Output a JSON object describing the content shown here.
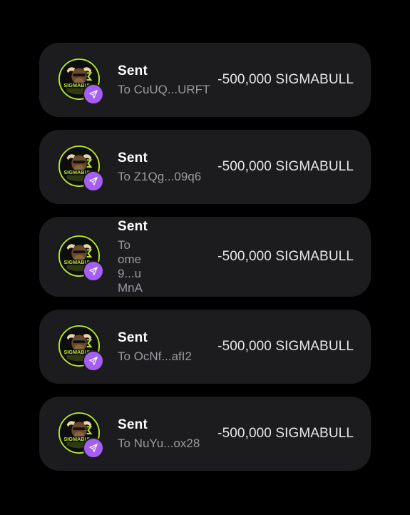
{
  "transactions": [
    {
      "title": "Sent",
      "recipient": "To CuUQ...URFT",
      "amount": "-500,000 SIGMABULL",
      "token_logo_text": "SIGMABULL",
      "token_icon": "sigmabull-logo-icon",
      "action_icon": "send-icon"
    },
    {
      "title": "Sent",
      "recipient": "To Z1Qg...09q6",
      "amount": "-500,000 SIGMABULL",
      "token_logo_text": "SIGMABULL",
      "token_icon": "sigmabull-logo-icon",
      "action_icon": "send-icon"
    },
    {
      "title": "Sent",
      "recipient": "To ome9...uMnA",
      "amount": "-500,000 SIGMABULL",
      "token_logo_text": "SIGMABULL",
      "token_icon": "sigmabull-logo-icon",
      "action_icon": "send-icon"
    },
    {
      "title": "Sent",
      "recipient": "To OcNf...afI2",
      "amount": "-500,000 SIGMABULL",
      "token_logo_text": "SIGMABULL",
      "token_icon": "sigmabull-logo-icon",
      "action_icon": "send-icon"
    },
    {
      "title": "Sent",
      "recipient": "To NuYu...ox28",
      "amount": "-500,000 SIGMABULL",
      "token_logo_text": "SIGMABULL",
      "token_icon": "sigmabull-logo-icon",
      "action_icon": "send-icon"
    }
  ],
  "colors": {
    "background": "#000000",
    "card": "#1c1c1e",
    "badge": "#a45ef2",
    "logo_green": "#b8e62a",
    "title_text": "#ffffff",
    "sub_text": "#9a9a9e"
  }
}
